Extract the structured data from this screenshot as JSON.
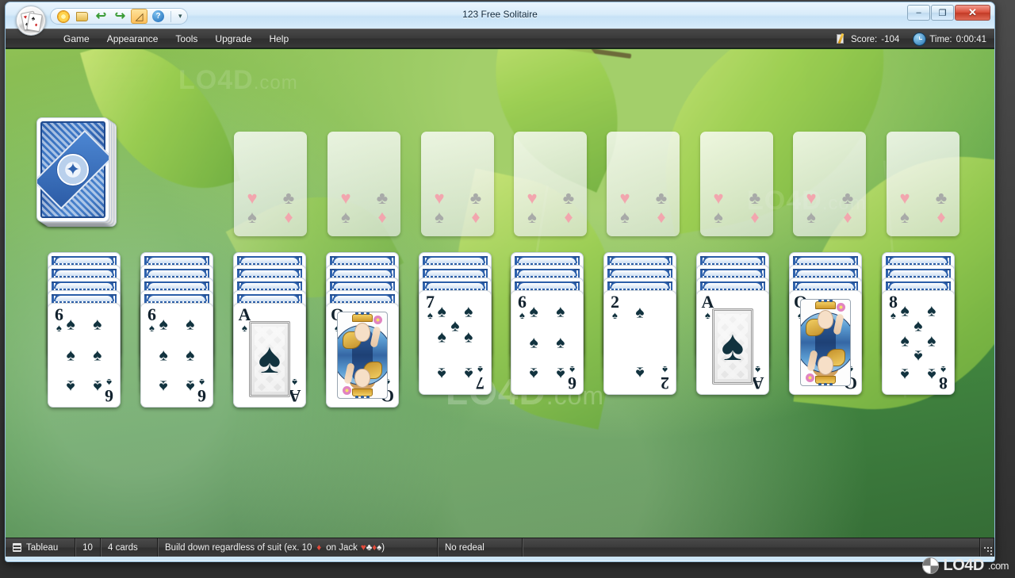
{
  "window": {
    "title": "123 Free Solitaire",
    "app_icon": "playing-cards-icon",
    "minimize": "–",
    "maximize": "❐",
    "close": "✕"
  },
  "quick_access": {
    "buttons": [
      {
        "name": "new-game-icon",
        "glyph": "☀",
        "tooltip": "New Game",
        "active": false
      },
      {
        "name": "open-game-icon",
        "glyph": "◨",
        "tooltip": "Open",
        "active": false
      },
      {
        "name": "undo-icon",
        "glyph": "↶",
        "tooltip": "Undo",
        "active": false
      },
      {
        "name": "redo-icon",
        "glyph": "↷",
        "tooltip": "Redo",
        "active": false
      },
      {
        "name": "statistics-icon",
        "glyph": "↗",
        "tooltip": "Statistics",
        "active": true
      },
      {
        "name": "help-icon",
        "glyph": "?",
        "tooltip": "Help",
        "active": false
      }
    ],
    "overflow": "▾"
  },
  "menu": {
    "items": [
      "Game",
      "Appearance",
      "Tools",
      "Upgrade",
      "Help"
    ]
  },
  "hud": {
    "score_label": "Score:",
    "score_value": "-104",
    "time_label": "Time:",
    "time_value": "0:00:41",
    "score_icon": "pencil-note-icon",
    "clock_icon": "clock-icon"
  },
  "statusbar": {
    "pile_icon": "tableau-icon",
    "pile_name": "Tableau",
    "pile_count": "10",
    "cards_per_pile": "4 cards",
    "rule_prefix": "Build down regardless of suit (ex. 10",
    "rule_suit_1": "♦",
    "rule_mid": "on Jack",
    "rule_suits": [
      "♥",
      "♣",
      "♦",
      "♠"
    ],
    "rule_suffix": ")",
    "redeal": "No redeal",
    "resize_grip": "resize-grip-icon"
  },
  "watermarks": {
    "center": "LO4D",
    "center_suffix": ".com",
    "topright": "LO4D",
    "topright_suffix": ".com",
    "topleft": "LO4D",
    "topleft_suffix": ".com",
    "logo": "LO4D",
    "logo_suffix": ".com"
  },
  "table": {
    "stock": {
      "name": "stock-pile",
      "face_down_count": 4,
      "back_design": "blue-ornate-back"
    },
    "foundations": [
      {
        "name": "foundation-1",
        "empty": true
      },
      {
        "name": "foundation-2",
        "empty": true
      },
      {
        "name": "foundation-3",
        "empty": true
      },
      {
        "name": "foundation-4",
        "empty": true
      },
      {
        "name": "foundation-5",
        "empty": true
      },
      {
        "name": "foundation-6",
        "empty": true
      },
      {
        "name": "foundation-7",
        "empty": true
      },
      {
        "name": "foundation-8",
        "empty": true
      }
    ],
    "foundation_ghost_suits": [
      "♥",
      "♣",
      "♠",
      "♦"
    ],
    "columns": [
      {
        "name": "tableau-column-1",
        "face_down": 4,
        "top_card": {
          "rank": "6",
          "suit": "♠",
          "suit_name": "spades",
          "color": "black",
          "type": "number"
        }
      },
      {
        "name": "tableau-column-2",
        "face_down": 4,
        "top_card": {
          "rank": "6",
          "suit": "♠",
          "suit_name": "spades",
          "color": "black",
          "type": "number"
        }
      },
      {
        "name": "tableau-column-3",
        "face_down": 4,
        "top_card": {
          "rank": "A",
          "suit": "♠",
          "suit_name": "spades",
          "color": "black",
          "type": "ace"
        }
      },
      {
        "name": "tableau-column-4",
        "face_down": 4,
        "top_card": {
          "rank": "Q",
          "suit": "♠",
          "suit_name": "spades",
          "color": "black",
          "type": "court"
        }
      },
      {
        "name": "tableau-column-5",
        "face_down": 3,
        "top_card": {
          "rank": "7",
          "suit": "♠",
          "suit_name": "spades",
          "color": "black",
          "type": "number"
        }
      },
      {
        "name": "tableau-column-6",
        "face_down": 3,
        "top_card": {
          "rank": "6",
          "suit": "♠",
          "suit_name": "spades",
          "color": "black",
          "type": "number"
        }
      },
      {
        "name": "tableau-column-7",
        "face_down": 3,
        "top_card": {
          "rank": "2",
          "suit": "♠",
          "suit_name": "spades",
          "color": "black",
          "type": "number"
        }
      },
      {
        "name": "tableau-column-8",
        "face_down": 3,
        "top_card": {
          "rank": "A",
          "suit": "♠",
          "suit_name": "spades",
          "color": "black",
          "type": "ace"
        }
      },
      {
        "name": "tableau-column-9",
        "face_down": 3,
        "top_card": {
          "rank": "Q",
          "suit": "♠",
          "suit_name": "spades",
          "color": "black",
          "type": "court"
        }
      },
      {
        "name": "tableau-column-10",
        "face_down": 3,
        "top_card": {
          "rank": "8",
          "suit": "♠",
          "suit_name": "spades",
          "color": "black",
          "type": "number"
        }
      }
    ]
  },
  "colors": {
    "felt_green": "#5aa346",
    "card_black": "#12333f",
    "card_red": "#e24a3a",
    "ghost_pink": "#f2a6ae",
    "ghost_gray": "#a8aaa8",
    "accent_orange": "#fdbf5a",
    "titlebar_blue": "#cfe6f8"
  }
}
